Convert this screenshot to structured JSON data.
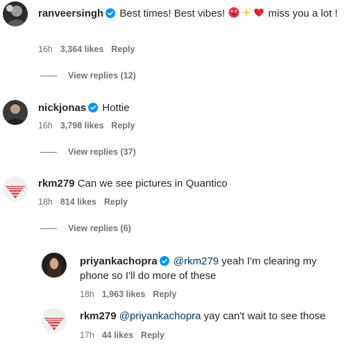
{
  "comments": [
    {
      "username": "ranveersingh",
      "verified": true,
      "text_before": "Best times! Best vibes! ",
      "emojis": [
        "smiling-face-with-heart-eyes",
        "sparkles",
        "red-heart"
      ],
      "text_after": " miss you a lot !",
      "time": "16h",
      "likes": "3,364 likes",
      "reply": "Reply",
      "view_replies": "View replies (12)"
    },
    {
      "username": "nickjonas",
      "verified": true,
      "text": "Hottie",
      "time": "16h",
      "likes": "3,798 likes",
      "reply": "Reply",
      "view_replies": "View replies (37)"
    },
    {
      "username": "rkm279",
      "verified": false,
      "text": "Can we see pictures in Quantico",
      "time": "18h",
      "likes": "814 likes",
      "reply": "Reply",
      "view_replies": "View replies (6)"
    }
  ],
  "replies": [
    {
      "username": "priyankachopra",
      "verified": true,
      "mention": "@rkm279",
      "text": " yeah I'm clearing my phone so I'll do more of these",
      "time": "18h",
      "likes": "1,963 likes",
      "reply": "Reply"
    },
    {
      "username": "rkm279",
      "verified": false,
      "mention": "@priyankachopra",
      "text": " yay can't wait to see those",
      "time": "17h",
      "likes": "44 likes",
      "reply": "Reply"
    }
  ],
  "colors": {
    "text": "#262626",
    "meta": "#737373",
    "mention": "#00376b",
    "verified": "#0095f6"
  }
}
